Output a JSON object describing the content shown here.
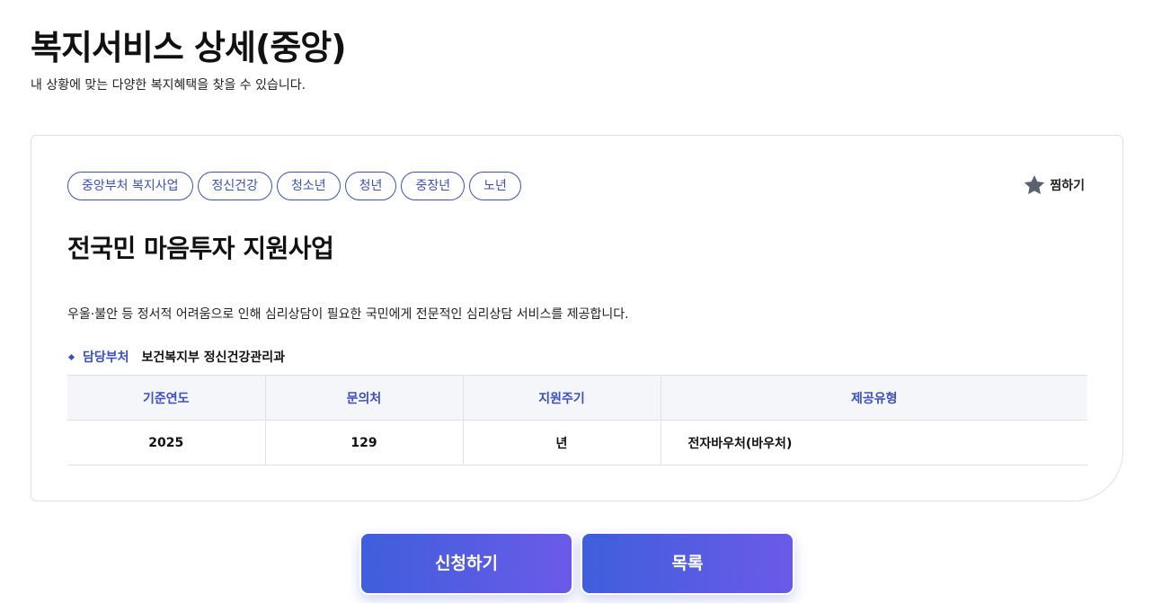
{
  "page": {
    "title": "복지서비스 상세(중앙)",
    "subtitle": "내 상황에 맞는 다양한 복지혜택을 찾을 수 있습니다."
  },
  "card": {
    "tags": [
      "중앙부처 복지사업",
      "정신건강",
      "청소년",
      "청년",
      "중장년",
      "노년"
    ],
    "bookmark": {
      "label": "찜하기",
      "icon": "star-icon",
      "icon_color": "#5b6170"
    },
    "title": "전국민 마음투자 지원사업",
    "description": "우울·불안 등 정서적 어려움으로 인해 심리상담이 필요한 국민에게 전문적인 심리상담 서비스를 제공합니다.",
    "department": {
      "label": "담당부처",
      "value": "보건복지부 정신건강관리과"
    },
    "table": {
      "headers": [
        "기준연도",
        "문의처",
        "지원주기",
        "제공유형"
      ],
      "row": [
        "2025",
        "129",
        "년",
        "전자바우처(바우처)"
      ]
    }
  },
  "actions": {
    "apply_label": "신청하기",
    "list_label": "목록"
  },
  "colors": {
    "accent": "#3b4fc4",
    "button_gradient_start": "#3f5fdc",
    "button_gradient_end": "#6b5ae8"
  }
}
